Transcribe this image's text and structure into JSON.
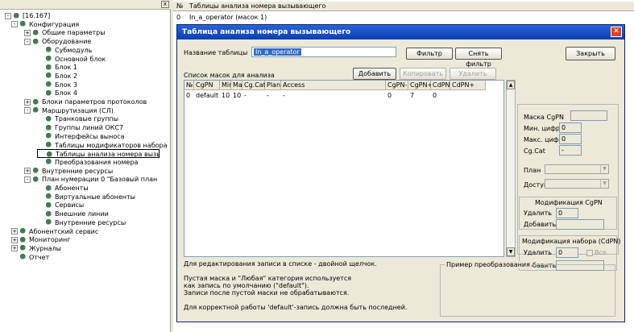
{
  "tree": {
    "close_label": "x",
    "nodes": [
      {
        "label": "[16.167]",
        "exp": "-",
        "icon": "server-icon"
      },
      {
        "label": "Конфигурация",
        "exp": "-",
        "icon": "config-icon"
      },
      {
        "label": "Общие параметры",
        "exp": "+",
        "icon": "leaf-icon"
      },
      {
        "label": "Оборудование",
        "exp": "-",
        "icon": "leaf-icon"
      },
      {
        "label": "Субмодуль",
        "exp": "",
        "icon": "leaf-icon"
      },
      {
        "label": "Основной блок",
        "exp": "",
        "icon": "leaf-icon"
      },
      {
        "label": "Блок 1",
        "exp": "",
        "icon": "leaf-icon"
      },
      {
        "label": "Блок 2",
        "exp": "",
        "icon": "leaf-icon"
      },
      {
        "label": "Блок 3",
        "exp": "",
        "icon": "leaf-icon"
      },
      {
        "label": "Блок 4",
        "exp": "",
        "icon": "leaf-icon"
      },
      {
        "label": "Блоки параметров протоколов",
        "exp": "+",
        "icon": "leaf-icon"
      },
      {
        "label": "Маршрутизация (СЛ)",
        "exp": "-",
        "icon": "leaf-icon"
      },
      {
        "label": "Транковые группы",
        "exp": "",
        "icon": "leaf-icon"
      },
      {
        "label": "Группы линий ОКС7",
        "exp": "",
        "icon": "leaf-icon"
      },
      {
        "label": "Интерфейсы выноса",
        "exp": "",
        "icon": "leaf-icon"
      },
      {
        "label": "Таблицы модификаторов набора",
        "exp": "",
        "icon": "leaf-icon"
      },
      {
        "label": "Таблицы анализа номера вызывающего",
        "exp": "",
        "icon": "leaf-icon"
      },
      {
        "label": "Преобразования номера",
        "exp": "",
        "icon": "leaf-icon"
      },
      {
        "label": "Внутренние ресурсы",
        "exp": "+",
        "icon": "resource-icon"
      },
      {
        "label": "План нумерации 0 \"Базовый план нумерации\"",
        "exp": "-",
        "icon": "leaf-icon"
      },
      {
        "label": "Абоненты",
        "exp": "",
        "icon": "leaf-icon"
      },
      {
        "label": "Виртуальные абоненты",
        "exp": "",
        "icon": "leaf-icon"
      },
      {
        "label": "Сервисы",
        "exp": "",
        "icon": "leaf-icon"
      },
      {
        "label": "Внешние линии",
        "exp": "",
        "icon": "leaf-icon"
      },
      {
        "label": "Внутренние ресурсы",
        "exp": "",
        "icon": "leaf-icon"
      },
      {
        "label": "Абонентский сервис",
        "exp": "+",
        "icon": "subscriber-icon"
      },
      {
        "label": "Мониторинг",
        "exp": "+",
        "icon": "monitor-icon"
      },
      {
        "label": "Журналы",
        "exp": "+",
        "icon": "journal-icon"
      },
      {
        "label": "Отчет",
        "exp": "",
        "icon": "report-icon"
      }
    ]
  },
  "background_list": {
    "headers": [
      "№",
      "Таблицы анализа номера вызывающего"
    ],
    "row": [
      "0",
      "In_a_operator (масок 1)"
    ]
  },
  "dialog": {
    "title": "Таблица анализа номера вызывающего",
    "close_label": "✕",
    "table_name_label": "Название таблицы",
    "table_name_value": "In_a_operator",
    "filter_button": "Фильтр",
    "clear_filter_button": "Снять фильтр",
    "close_button": "Закрыть",
    "mask_list_label": "Список масок для анализа",
    "add_button": "Добавить",
    "copy_button": "Копировать",
    "delete_button": "Удалить",
    "columns": [
      "№",
      "CgPN",
      "Min",
      "Max",
      "Cg.Cat",
      "Plan",
      "Access",
      "CgPN-",
      "CgPN+",
      "CdPN-",
      "CdPN+"
    ],
    "rows": [
      [
        "0",
        "default",
        "10",
        "10",
        "-",
        "-",
        "-",
        "0",
        "7",
        "0",
        ""
      ]
    ],
    "right_panel": {
      "mask_label": "Маска CgPN",
      "min_label": "Мин. цифр",
      "min_value": "0",
      "max_label": "Макс. цифр",
      "max_value": "0",
      "cat_label": "Cg.Cat",
      "cat_value": "-",
      "plan_label": "План",
      "access_label": "Доступ",
      "mod_cgpn_title": "Модификация CgPN",
      "delete_label": "Удалить",
      "delete_value": "0",
      "add_label": "Добавить",
      "mod_cdpn_title": "Модификация набора (CdPN)",
      "delete2_label": "Удалить",
      "delete2_value": "0",
      "all_label": "Все",
      "add2_label": "Добавить"
    },
    "hint_edit": "Для редактирования записи в списке - двойной щелчок.",
    "hint_empty_1": "Пустая маска и \"Любая\" категория используется",
    "hint_empty_2": "как запись по умолчанию (\"default\").",
    "hint_empty_3": "Записи после пустой маски не обрабатываются.",
    "hint_default": "Для корректной работы 'default'-запись должна быть последней.",
    "example_title": "Пример преобразования"
  }
}
